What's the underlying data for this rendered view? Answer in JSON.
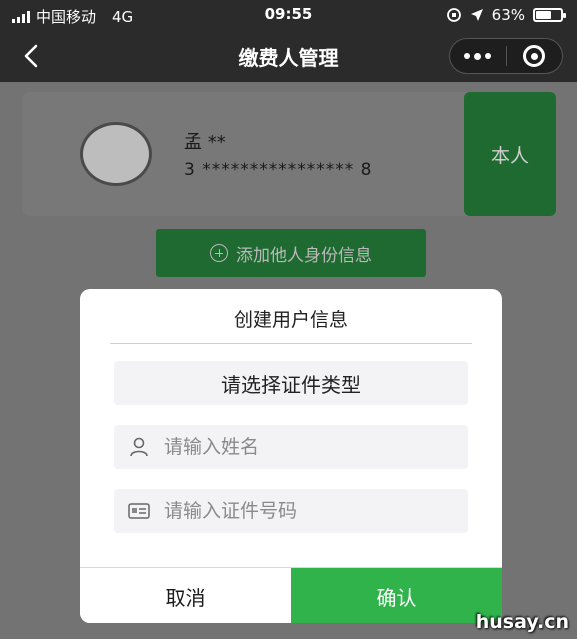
{
  "status_bar": {
    "carrier": "中国移动",
    "network": "4G",
    "time": "09:55",
    "battery_text": "63%",
    "battery_level": 0.63
  },
  "nav": {
    "title": "缴费人管理",
    "back_icon": "chevron-left-icon",
    "more_icon": "more-dots-icon",
    "close_icon": "target-close-icon"
  },
  "payer_card": {
    "name": "孟 **",
    "id_number": "3 **************** 8",
    "badge": "本人"
  },
  "add_button": {
    "label": "添加他人身份信息"
  },
  "modal": {
    "title": "创建用户信息",
    "id_type_label": "请选择证件类型",
    "name_placeholder": "请输入姓名",
    "idno_placeholder": "请输入证件号码",
    "cancel_label": "取消",
    "confirm_label": "确认"
  },
  "watermark": "husay.cn",
  "colors": {
    "primary_green": "#2fb34a",
    "dimmed_green": "#1f6a31",
    "nav_background": "#2b2b2b"
  }
}
